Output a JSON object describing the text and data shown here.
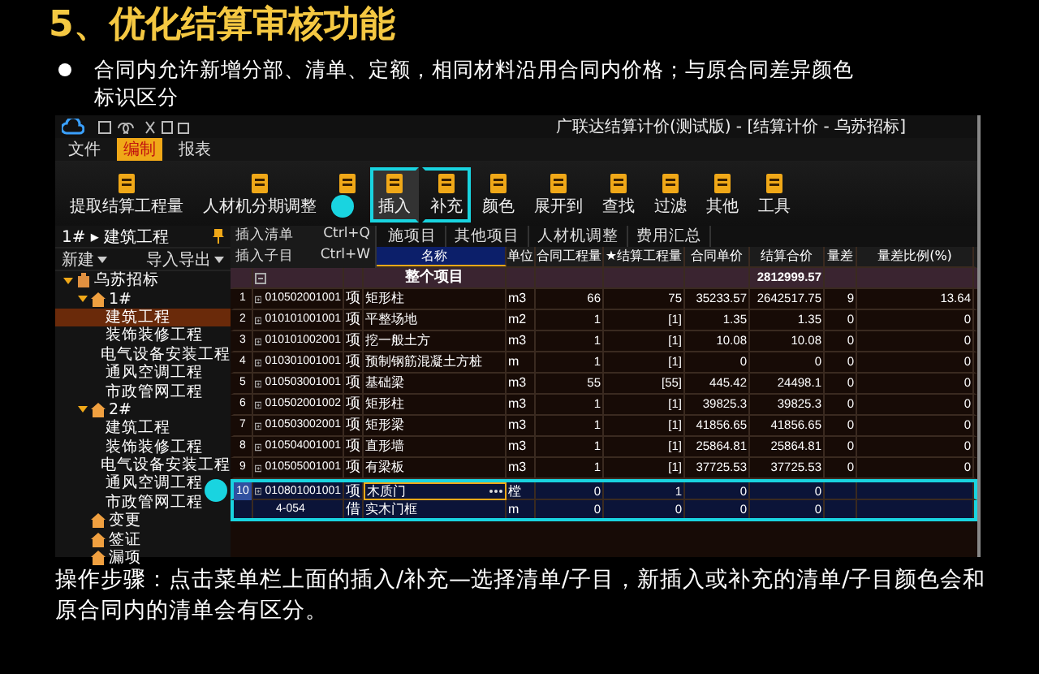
{
  "slide": {
    "title": "5、优化结算审核功能",
    "bullet": "合同内允许新增分部、清单、定额，相同材料沿用合同内价格；与原合同差异颜色标识区分",
    "steps": "操作步骤：点击菜单栏上面的插入/补充—选择清单/子目，新插入或补充的清单/子目颜色会和原合同内的清单会有区分。"
  },
  "app": {
    "title": "广联达结算计价(测试版) - [结算计价 - 乌苏招标]",
    "menu": [
      {
        "label": "文件",
        "selected": false
      },
      {
        "label": "编制",
        "selected": true
      },
      {
        "label": "报表",
        "selected": false
      }
    ],
    "toolbar": [
      {
        "label": "提取结算工程量",
        "selected": false,
        "callout": false
      },
      {
        "label": "人材机分期调整",
        "selected": false,
        "callout": false
      },
      {
        "selected": false,
        "callout": false
      },
      {
        "label": "插入",
        "selected": true,
        "callout": true
      },
      {
        "label": "补充",
        "selected": false,
        "callout": true
      },
      {
        "label": "颜色",
        "selected": false,
        "callout": false
      },
      {
        "label": "展开到",
        "selected": false,
        "callout": false
      },
      {
        "label": "查找",
        "selected": false,
        "callout": false
      },
      {
        "label": "过滤",
        "selected": false,
        "callout": false
      },
      {
        "label": "其他",
        "selected": false,
        "callout": false
      },
      {
        "label": "工具",
        "selected": false,
        "callout": false
      }
    ],
    "sidebar": {
      "breadcrumb": "1# ▸ 建筑工程",
      "actions": [
        "新建",
        "导入导出"
      ],
      "tree": [
        {
          "label": "乌苏招标",
          "kind": "project",
          "expanded": true,
          "selected": false,
          "children": [
            {
              "label": "1#",
              "kind": "group",
              "expanded": true,
              "selected": false,
              "children": [
                {
                  "label": "建筑工程",
                  "selected": true
                },
                {
                  "label": "装饰装修工程",
                  "selected": false
                },
                {
                  "label": "电气设备安装工程",
                  "selected": false
                },
                {
                  "label": "通风空调工程",
                  "selected": false
                },
                {
                  "label": "市政管网工程",
                  "selected": false
                }
              ]
            },
            {
              "label": "2#",
              "kind": "group",
              "expanded": true,
              "selected": false,
              "children": [
                {
                  "label": "建筑工程",
                  "selected": false
                },
                {
                  "label": "装饰装修工程",
                  "selected": false
                },
                {
                  "label": "电气设备安装工程",
                  "selected": false
                },
                {
                  "label": "通风空调工程",
                  "selected": false
                },
                {
                  "label": "市政管网工程",
                  "selected": false
                }
              ]
            },
            {
              "label": "变更",
              "kind": "group",
              "selected": false
            },
            {
              "label": "签证",
              "kind": "group",
              "selected": false
            },
            {
              "label": "漏项",
              "kind": "group",
              "selected": false
            }
          ]
        }
      ]
    },
    "tabs": [
      "施项目",
      "其他项目",
      "人材机调整",
      "费用汇总"
    ],
    "insert_menu": [
      {
        "label": "插入清单",
        "shortcut": "Ctrl+Q"
      },
      {
        "label": "插入子目",
        "shortcut": "Ctrl+W"
      }
    ],
    "columns": [
      "名称",
      "单位",
      "合同工程量",
      "★结算工程量",
      "合同单价",
      "结算合价",
      "量差",
      "量差比例(%)"
    ],
    "total_row": {
      "name": "整个项目",
      "amount": "2812999.57"
    },
    "rows": [
      {
        "num": "1",
        "code": "010502001001",
        "type": "项",
        "name": "矩形柱",
        "unit": "m3",
        "qty": "66",
        "settle_qty": "75",
        "price": "35233.57",
        "amount": "2642517.75",
        "diff": "9",
        "ratio": "13.64",
        "new": false,
        "kind": "list"
      },
      {
        "num": "2",
        "code": "010101001001",
        "type": "项",
        "name": "平整场地",
        "unit": "m2",
        "qty": "1",
        "settle_qty": "[1]",
        "price": "1.35",
        "amount": "1.35",
        "diff": "0",
        "ratio": "0",
        "new": false,
        "kind": "list"
      },
      {
        "num": "3",
        "code": "010101002001",
        "type": "项",
        "name": "挖一般土方",
        "unit": "m3",
        "qty": "1",
        "settle_qty": "[1]",
        "price": "10.08",
        "amount": "10.08",
        "diff": "0",
        "ratio": "0",
        "new": false,
        "kind": "list"
      },
      {
        "num": "4",
        "code": "010301001001",
        "type": "项",
        "name": "预制钢筋混凝土方桩",
        "unit": "m",
        "qty": "1",
        "settle_qty": "[1]",
        "price": "0",
        "amount": "0",
        "diff": "0",
        "ratio": "0",
        "new": false,
        "kind": "list"
      },
      {
        "num": "5",
        "code": "010503001001",
        "type": "项",
        "name": "基础梁",
        "unit": "m3",
        "qty": "55",
        "settle_qty": "[55]",
        "price": "445.42",
        "amount": "24498.1",
        "diff": "0",
        "ratio": "0",
        "new": false,
        "kind": "list"
      },
      {
        "num": "6",
        "code": "010502001002",
        "type": "项",
        "name": "矩形柱",
        "unit": "m3",
        "qty": "1",
        "settle_qty": "[1]",
        "price": "39825.3",
        "amount": "39825.3",
        "diff": "0",
        "ratio": "0",
        "new": false,
        "kind": "list"
      },
      {
        "num": "7",
        "code": "010503002001",
        "type": "项",
        "name": "矩形梁",
        "unit": "m3",
        "qty": "1",
        "settle_qty": "[1]",
        "price": "41856.65",
        "amount": "41856.65",
        "diff": "0",
        "ratio": "0",
        "new": false,
        "kind": "list"
      },
      {
        "num": "8",
        "code": "010504001001",
        "type": "项",
        "name": "直形墙",
        "unit": "m3",
        "qty": "1",
        "settle_qty": "[1]",
        "price": "25864.81",
        "amount": "25864.81",
        "diff": "0",
        "ratio": "0",
        "new": false,
        "kind": "list"
      },
      {
        "num": "9",
        "code": "010505001001",
        "type": "项",
        "name": "有梁板",
        "unit": "m3",
        "qty": "1",
        "settle_qty": "[1]",
        "price": "37725.53",
        "amount": "37725.53",
        "diff": "0",
        "ratio": "0",
        "new": false,
        "kind": "list"
      },
      {
        "num": "10",
        "code": "010801001001",
        "type": "项",
        "name": "木质门",
        "unit": "樘",
        "qty": "0",
        "settle_qty": "1",
        "price": "0",
        "amount": "0",
        "new": true,
        "kind": "list"
      },
      {
        "code": "4-054",
        "type": "借",
        "name": "实木门框",
        "unit": "m",
        "qty": "0",
        "settle_qty": "0",
        "price": "0",
        "amount": "0",
        "new": true,
        "kind": "item"
      }
    ]
  }
}
